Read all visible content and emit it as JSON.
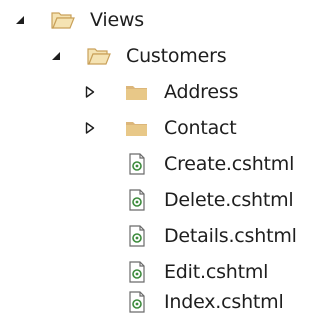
{
  "tree": {
    "views": {
      "label": "Views",
      "state": "expanded",
      "icon": "folder-open-icon"
    },
    "customers": {
      "label": "Customers",
      "state": "expanded",
      "icon": "folder-open-icon"
    },
    "folders": [
      {
        "label": "Address",
        "state": "collapsed",
        "icon": "folder-icon"
      },
      {
        "label": "Contact",
        "state": "collapsed",
        "icon": "folder-icon"
      }
    ],
    "files": [
      {
        "label": "Create.cshtml",
        "icon": "razor-file-icon"
      },
      {
        "label": "Delete.cshtml",
        "icon": "razor-file-icon"
      },
      {
        "label": "Details.cshtml",
        "icon": "razor-file-icon"
      },
      {
        "label": "Edit.cshtml",
        "icon": "razor-file-icon"
      },
      {
        "label": "Index.cshtml",
        "icon": "razor-file-icon"
      }
    ]
  },
  "colors": {
    "folder_fill": "#dcb67a",
    "folder_open_fill": "#f5e3b3",
    "folder_stroke": "#c9a15a",
    "file_stroke": "#6b6b6b",
    "razor_green": "#3c8b3c",
    "arrow": "#1e1e1e"
  }
}
